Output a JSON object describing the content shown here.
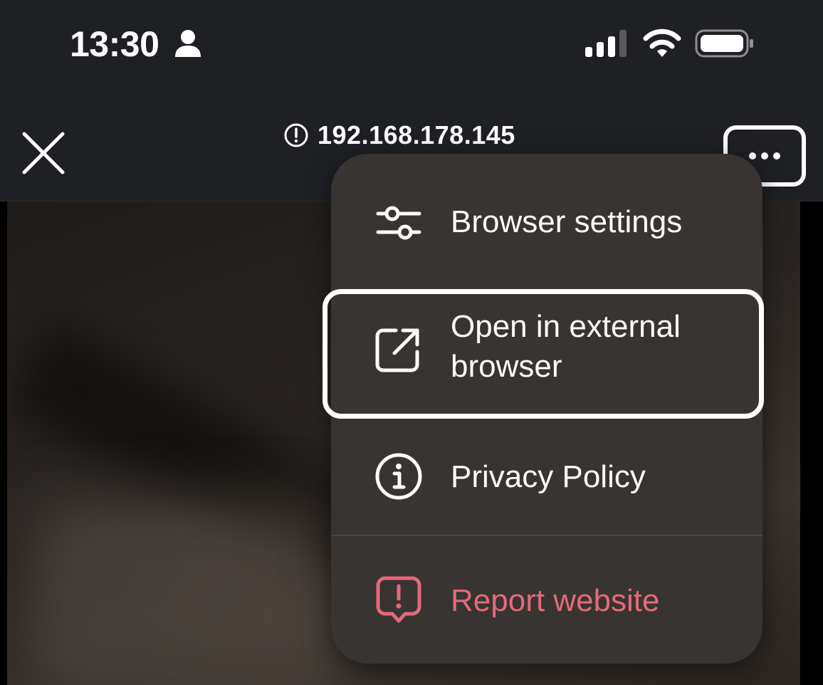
{
  "status_bar": {
    "time": "13:30"
  },
  "header": {
    "url": "192.168.178.145"
  },
  "menu": {
    "items": [
      {
        "label": "Browser settings",
        "icon": "sliders-icon"
      },
      {
        "label": "Open in external\nbrowser",
        "icon": "external-link-icon"
      },
      {
        "label": "Privacy Policy",
        "icon": "info-icon"
      },
      {
        "label": "Report website",
        "icon": "report-icon",
        "color": "#e5697c"
      }
    ]
  },
  "colors": {
    "topbar": "#1f2024",
    "menu_bg": "#373432",
    "danger": "#e5697c"
  }
}
